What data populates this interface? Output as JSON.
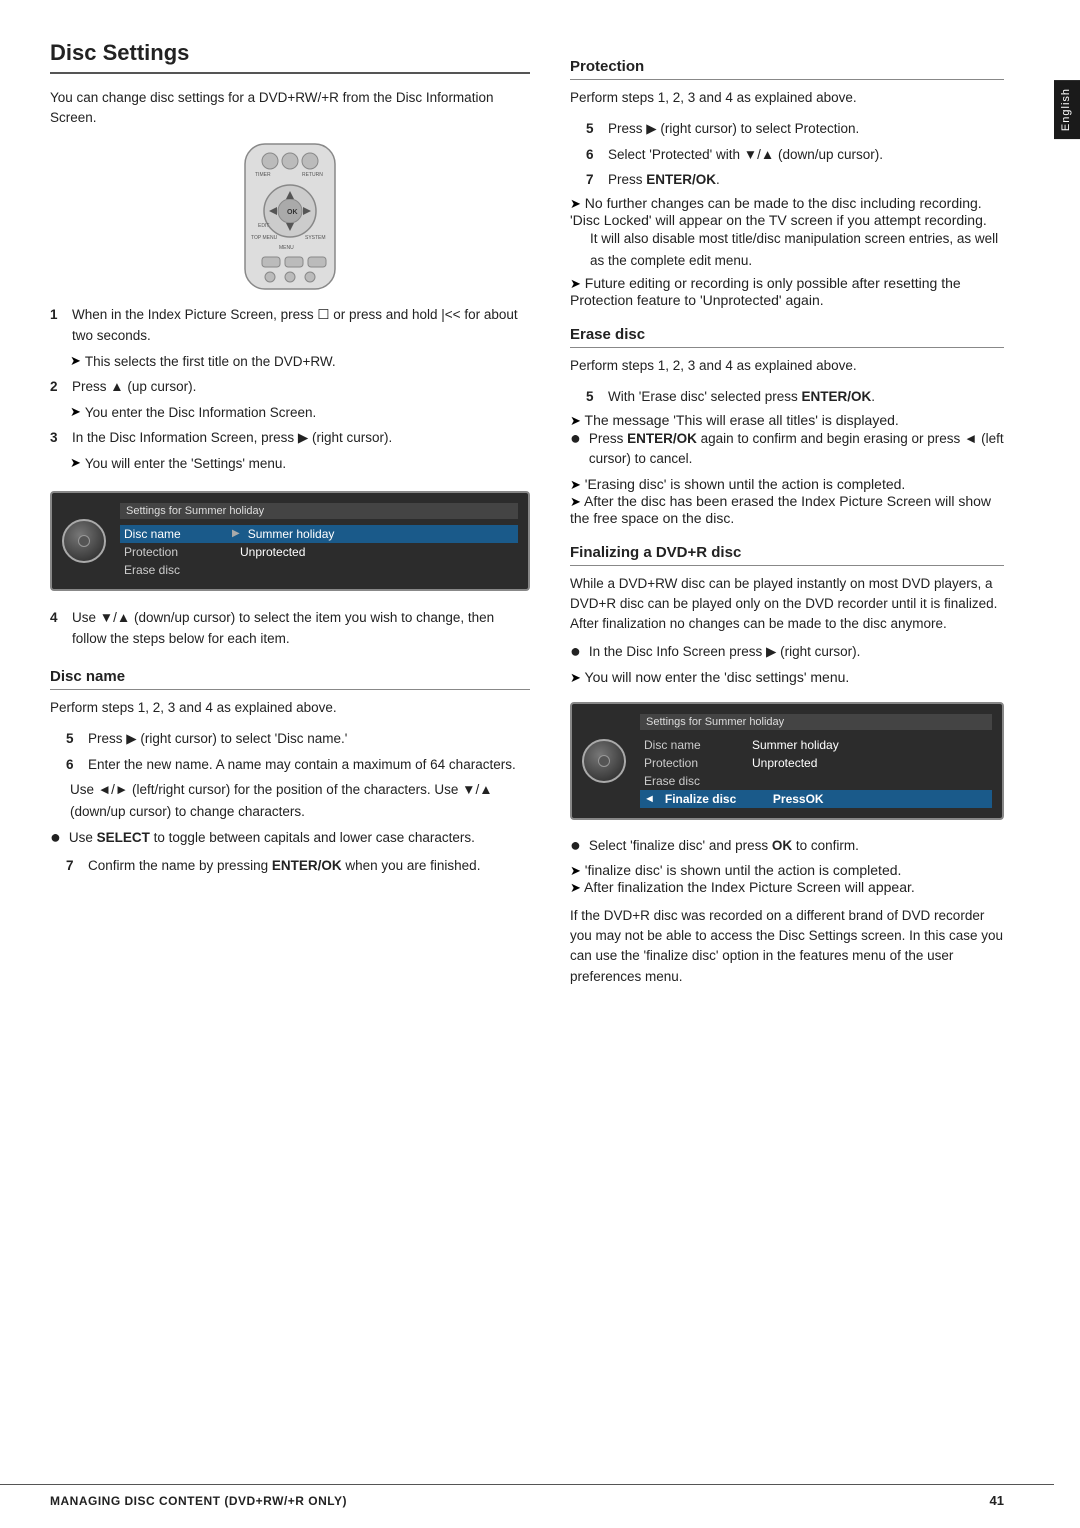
{
  "page": {
    "title": "Disc Settings",
    "intro": "You can change disc settings for a DVD+RW/+R from the Disc Information Screen."
  },
  "side_tab": {
    "label": "English"
  },
  "steps_main": [
    {
      "num": "1",
      "text": "When in the Index Picture Screen, press ☐ or press and hold |<< for about two seconds.",
      "sub": "This selects the first title on the DVD+RW."
    },
    {
      "num": "2",
      "text": "Press ▲ (up cursor).",
      "sub": "You enter the Disc Information Screen."
    },
    {
      "num": "3",
      "text": "In the Disc Information Screen, press ▶ (right cursor).",
      "sub": "You will enter the 'Settings' menu."
    }
  ],
  "screen1": {
    "title": "Settings for Summer holiday",
    "rows": [
      {
        "label": "Disc name",
        "arrow": "▶",
        "value": "Summer holiday",
        "selected": true
      },
      {
        "label": "Protection",
        "arrow": "",
        "value": "Unprotected",
        "selected": false
      },
      {
        "label": "Erase disc",
        "arrow": "",
        "value": "",
        "selected": false
      }
    ]
  },
  "step4": {
    "text": "Use ▼/▲ (down/up cursor) to select the item you wish to change, then follow the steps below for each item."
  },
  "disc_name": {
    "header": "Disc name",
    "intro": "Perform steps 1, 2, 3 and 4 as explained above.",
    "steps": [
      {
        "num": "5",
        "text": "Press ▶ (right cursor) to select 'Disc name.'"
      },
      {
        "num": "6",
        "text": "Enter the new name. A name may contain a maximum of 64 characters."
      }
    ],
    "notes": [
      "Use ◄/► (left/right cursor) for the position of the characters. Use ▼/▲ (down/up cursor) to change characters.",
      "Use SELECT to toggle between capitals and lower case characters."
    ],
    "step7": "Confirm the name by pressing ENTER/OK when you are finished."
  },
  "protection": {
    "header": "Protection",
    "intro": "Perform steps 1, 2, 3 and 4 as explained above.",
    "steps": [
      {
        "num": "5",
        "text": "Press ▶ (right cursor) to select Protection."
      },
      {
        "num": "6",
        "text": "Select 'Protected' with ▼/▲ (down/up cursor)."
      },
      {
        "num": "7",
        "text": "Press ENTER/OK."
      }
    ],
    "notes": [
      "No further changes can be made to the disc including recording. 'Disc Locked' will appear on the TV screen if you attempt recording.",
      "It will also disable most title/disc manipulation screen entries, as well as the complete edit menu.",
      "Future editing or recording is only possible after resetting the Protection feature to 'Unprotected' again."
    ]
  },
  "erase_disc": {
    "header": "Erase disc",
    "intro": "Perform steps 1, 2, 3 and 4 as explained above.",
    "steps": [
      {
        "num": "5",
        "text": "With 'Erase disc' selected press ENTER/OK."
      }
    ],
    "notes": [
      "The message 'This will erase all titles' is displayed.",
      "Press ENTER/OK again to confirm and begin erasing or press ◄ (left cursor) to cancel.",
      "'Erasing disc' is shown until the action is completed.",
      "After the disc has been erased the Index Picture Screen will show the free space on the disc."
    ]
  },
  "finalizing": {
    "header": "Finalizing a DVD+R disc",
    "intro": "While a DVD+RW disc can be played instantly on most DVD players, a DVD+R disc can be played only on the DVD recorder until it is finalized. After finalization no changes can be made to the disc anymore.",
    "bullet1": "In the Disc Info Screen press ▶ (right cursor).",
    "bullet1_sub": "You will now enter the 'disc settings' menu.",
    "screen2": {
      "title": "Settings for Summer holiday",
      "rows": [
        {
          "label": "Disc name",
          "value": "Summer holiday",
          "selected": false
        },
        {
          "label": "Protection",
          "value": "Unprotected",
          "selected": false
        },
        {
          "label": "Erase disc",
          "value": "",
          "selected": false
        },
        {
          "label": "Finalize disc",
          "value": "PressOK",
          "selected": true,
          "arrow_left": "◄"
        }
      ]
    },
    "notes": [
      "Select 'finalize disc' and press OK to confirm.",
      "'finalize disc' is shown until the action is completed.",
      "After finalization the Index Picture Screen will appear."
    ],
    "footer_note": "If the DVD+R disc was recorded on a different brand of DVD recorder you may not be able to access the Disc Settings screen. In this case you can use the 'finalize disc' option in the features menu of the user preferences menu."
  },
  "footer": {
    "left": "Managing disc content (DVD+RW/+R only)",
    "right": "41"
  }
}
